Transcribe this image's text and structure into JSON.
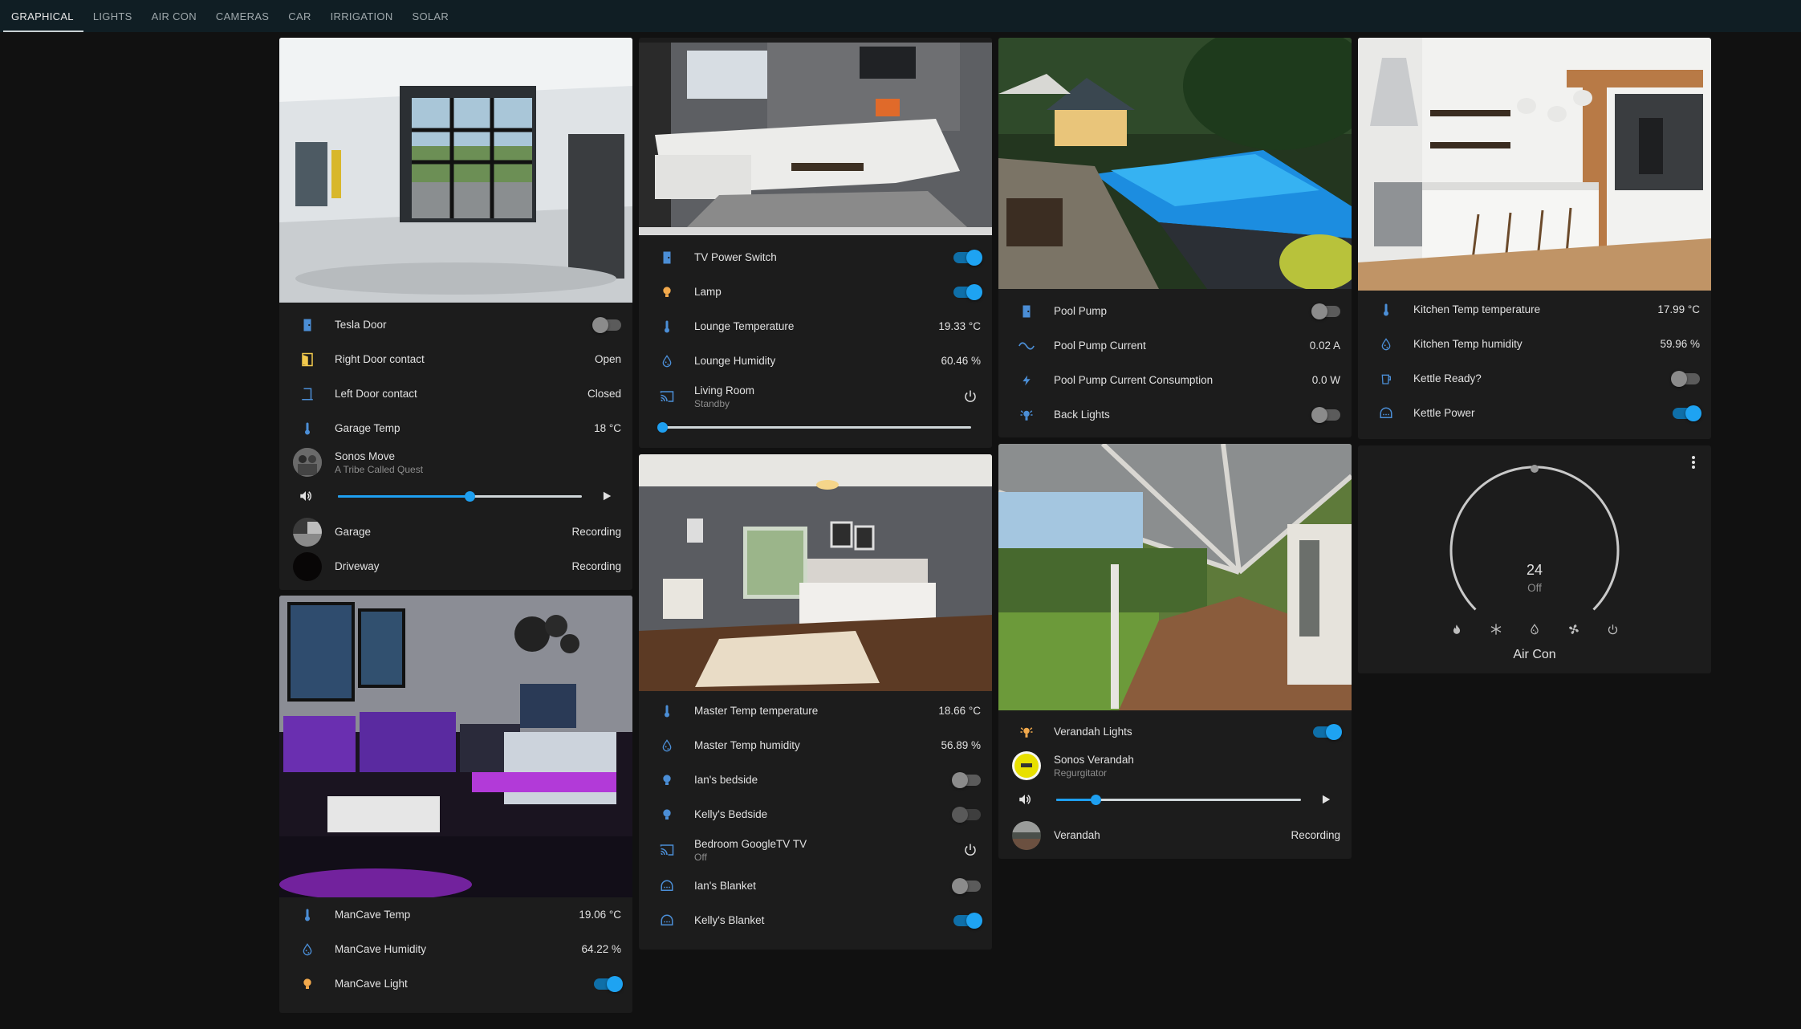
{
  "tabs": [
    "GRAPHICAL",
    "LIGHTS",
    "AIR CON",
    "CAMERAS",
    "CAR",
    "IRRIGATION",
    "SOLAR"
  ],
  "accent": "#1ea3f2",
  "garage": {
    "tesla_door": "Tesla Door",
    "right_door": "Right Door contact",
    "right_door_state": "Open",
    "left_door": "Left Door contact",
    "left_door_state": "Closed",
    "temp": "Garage Temp",
    "temp_value": "18 °C",
    "sonos": "Sonos Move",
    "sonos_artist": "A Tribe Called Quest",
    "sonos_volume": 0.54,
    "cam_garage": "Garage",
    "cam_garage_state": "Recording",
    "cam_driveway": "Driveway",
    "cam_driveway_state": "Recording"
  },
  "mancave": {
    "temp": "ManCave Temp",
    "temp_value": "19.06 °C",
    "humidity": "ManCave Humidity",
    "humidity_value": "64.22 %",
    "light": "ManCave Light"
  },
  "lounge": {
    "tv_power": "TV Power Switch",
    "lamp": "Lamp",
    "temp": "Lounge Temperature",
    "temp_value": "19.33 °C",
    "humidity": "Lounge Humidity",
    "humidity_value": "60.46 %",
    "media": "Living Room",
    "media_state": "Standby",
    "media_volume": 0.0
  },
  "master": {
    "temp": "Master Temp temperature",
    "temp_value": "18.66 °C",
    "humidity": "Master Temp humidity",
    "humidity_value": "56.89 %",
    "ian_bedside": "Ian's bedside",
    "kelly_bedside": "Kelly's Bedside",
    "tv": "Bedroom GoogleTV TV",
    "tv_state": "Off",
    "ian_blanket": "Ian's Blanket",
    "kelly_blanket": "Kelly's Blanket"
  },
  "pool": {
    "pump": "Pool Pump",
    "current": "Pool Pump Current",
    "current_value": "0.02 A",
    "consumption": "Pool Pump Current Consumption",
    "consumption_value": "0.0 W",
    "back_lights": "Back Lights"
  },
  "verandah": {
    "lights": "Verandah Lights",
    "sonos": "Sonos Verandah",
    "sonos_artist": "Regurgitator",
    "sonos_volume": 0.16,
    "cam": "Verandah",
    "cam_state": "Recording"
  },
  "kitchen": {
    "temp": "Kitchen Temp temperature",
    "temp_value": "17.99 °C",
    "humidity": "Kitchen Temp humidity",
    "humidity_value": "59.96 %",
    "kettle_ready": "Kettle Ready?",
    "kettle_power": "Kettle Power"
  },
  "aircon": {
    "setpoint": "24",
    "state": "Off",
    "name": "Air Con",
    "modes": [
      "heat-icon",
      "cool-icon",
      "dry-icon",
      "fan-icon",
      "power-icon"
    ]
  },
  "toggles": {
    "tesla_door": false,
    "mancave_light": true,
    "tv_power": true,
    "lamp": true,
    "ian_bedside": false,
    "kelly_bedside": false,
    "ian_blanket": false,
    "kelly_blanket": true,
    "pool_pump": false,
    "back_lights": false,
    "verandah_lights": true,
    "kettle_ready": false,
    "kettle_power": true
  }
}
